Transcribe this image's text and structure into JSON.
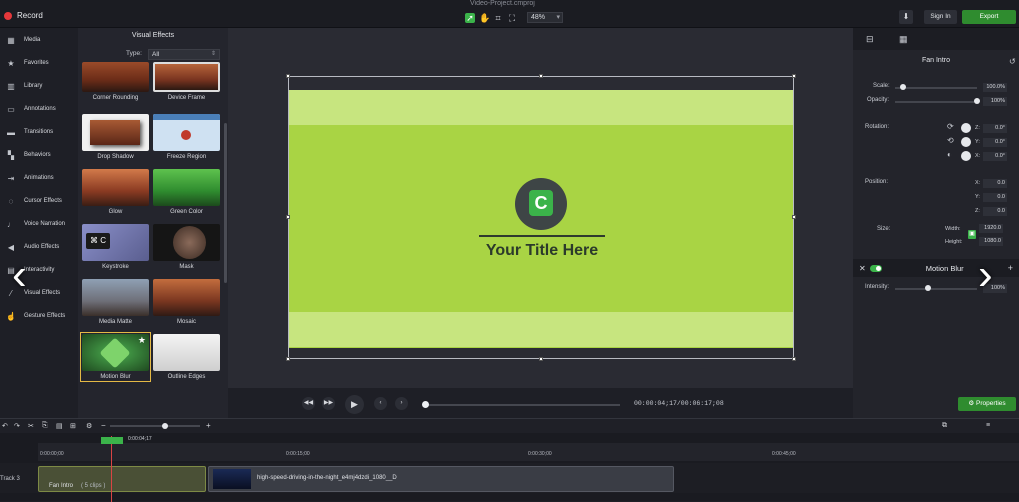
{
  "app": {
    "record_label": "Record",
    "window_title": "Video-Project.cmproj",
    "zoom": "48%",
    "sign_in": "Sign In",
    "export": "Export"
  },
  "nav": {
    "items": [
      {
        "label": "Media",
        "icon": "film-icon"
      },
      {
        "label": "Favorites",
        "icon": "star-icon"
      },
      {
        "label": "Library",
        "icon": "library-icon"
      },
      {
        "label": "Annotations",
        "icon": "annotation-icon"
      },
      {
        "label": "Transitions",
        "icon": "transition-icon"
      },
      {
        "label": "Behaviors",
        "icon": "behavior-icon"
      },
      {
        "label": "Animations",
        "icon": "animation-icon"
      },
      {
        "label": "Cursor Effects",
        "icon": "cursor-icon"
      },
      {
        "label": "Voice Narration",
        "icon": "mic-icon"
      },
      {
        "label": "Audio Effects",
        "icon": "speaker-icon"
      },
      {
        "label": "Interactivity",
        "icon": "interactivity-icon"
      },
      {
        "label": "Visual Effects",
        "icon": "wand-icon"
      },
      {
        "label": "Gesture Effects",
        "icon": "hand-icon"
      }
    ]
  },
  "effects_panel": {
    "title": "Visual Effects",
    "type_label": "Type:",
    "type_value": "All",
    "tiles": [
      {
        "label": "Corner Rounding"
      },
      {
        "label": "Device Frame"
      },
      {
        "label": "Drop Shadow"
      },
      {
        "label": "Freeze Region"
      },
      {
        "label": "Glow"
      },
      {
        "label": "Green  Color"
      },
      {
        "label": "Keystroke",
        "text": "⌘ C"
      },
      {
        "label": "Mask"
      },
      {
        "label": "Media Matte"
      },
      {
        "label": "Mosaic"
      },
      {
        "label": "Motion Blur"
      },
      {
        "label": "Outline Edges"
      }
    ]
  },
  "canvas": {
    "title_text": "Your Title Here",
    "logo_letter": "C",
    "bg_color": "#a9d444",
    "stripe_color": "#c7e57f"
  },
  "transport": {
    "timecode": "00:00:04;17/00:06:17;08"
  },
  "properties": {
    "title": "Fan Intro",
    "scale_label": "Scale:",
    "scale_value": "100.0%",
    "scale_level": 0.1,
    "opacity_label": "Opacity:",
    "opacity_value": "100%",
    "opacity_level": 1.0,
    "rotation_label": "Rotation:",
    "rot_z": "0.0°",
    "rot_y": "0.0°",
    "rot_x": "0.0°",
    "position_label": "Position:",
    "pos_x": "0.0",
    "pos_y": "0.0",
    "pos_z": "0.0",
    "size_label": "Size:",
    "width_label": "Width:",
    "width_value": "1920.0",
    "height_label": "Height:",
    "height_value": "1080.0",
    "motion_blur_title": "Motion Blur",
    "intensity_label": "Intensity:",
    "intensity_value": "100%",
    "intensity_level": 0.4,
    "z": "Z:",
    "y": "Y:",
    "x": "X:",
    "properties_button": "Properties"
  },
  "timeline": {
    "playhead_time": "0:00:04;17",
    "ruler": [
      "0:00:00;00",
      "0:00:15;00",
      "0:00:30;00",
      "0:00:45;00"
    ],
    "track_label": "Track 3",
    "clip1_title": "Fan Intro",
    "clip1_sub": "( 5 clips )",
    "clip2_title": "high-speed-driving-in-the-night_e4mj4dzdi_1080__D"
  }
}
